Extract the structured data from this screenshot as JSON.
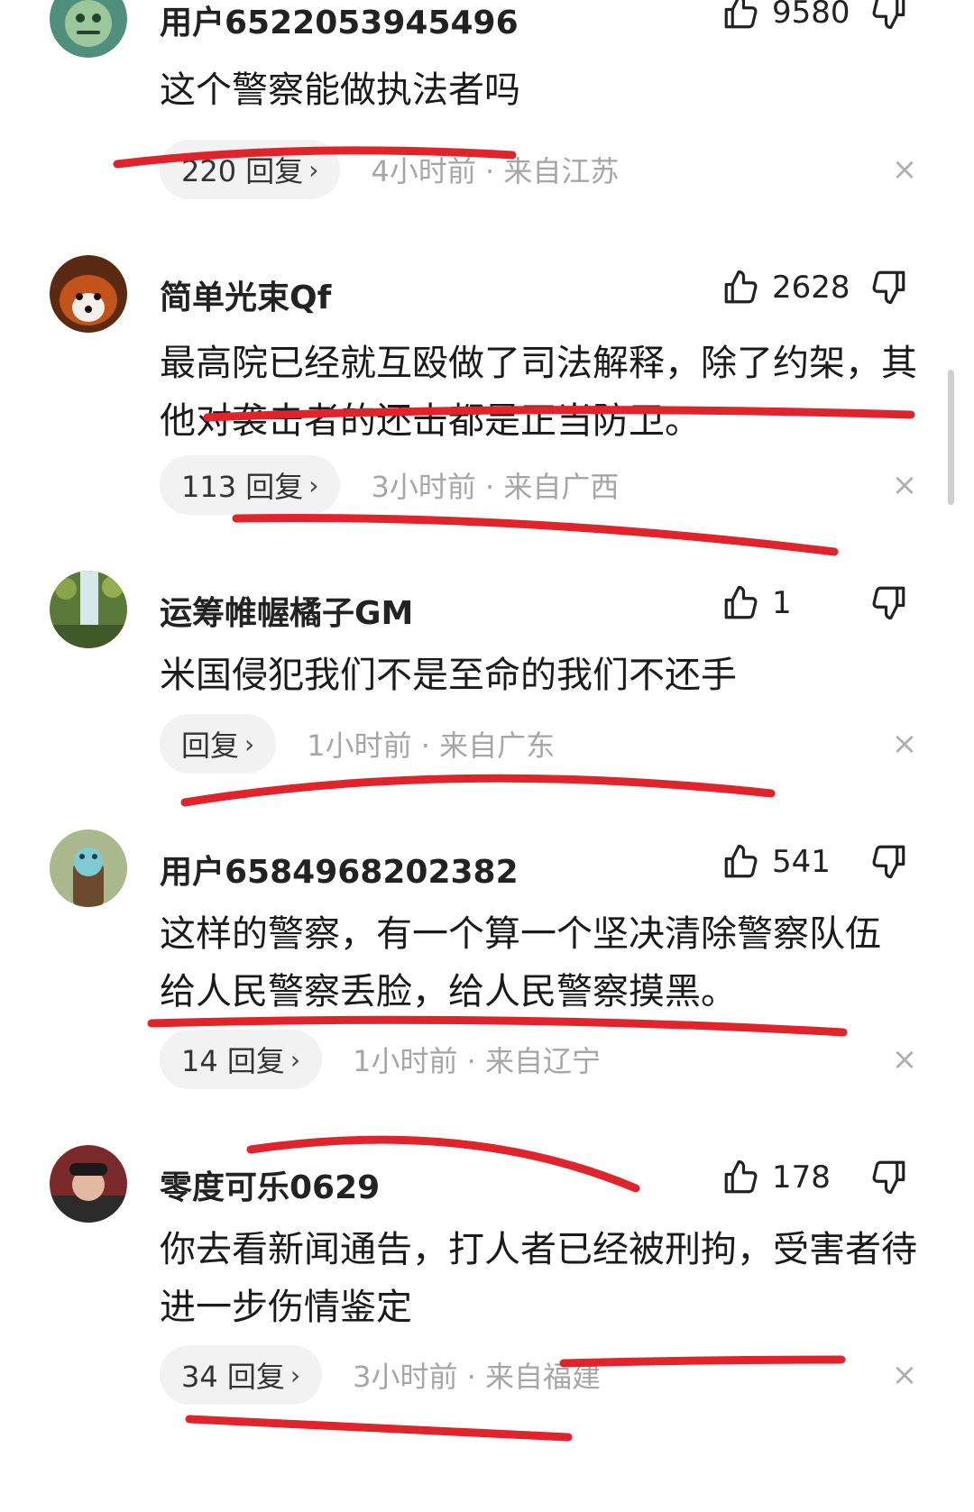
{
  "comments": [
    {
      "username": "用户6522053945496",
      "likes": "9580",
      "text": "这个警察能做执法者吗",
      "reply_label": "220 回复",
      "meta": "4小时前 · 来自江苏"
    },
    {
      "username": "简单光束Qf",
      "likes": "2628",
      "text": "最高院已经就互殴做了司法解释，除了约架，其他对袭击者的还击都是正当防卫。",
      "reply_label": "113 回复",
      "meta": "3小时前 · 来自广西"
    },
    {
      "username": "运筹帷幄橘子GM",
      "likes": "1",
      "text": "米国侵犯我们不是至命的我们不还手",
      "reply_label": "回复",
      "meta": "1小时前 · 来自广东"
    },
    {
      "username": "用户6584968202382",
      "likes": "541",
      "text": "这样的警察，有一个算一个坚决清除警察队伍 给人民警察丢脸，给人民警察摸黑。",
      "reply_label": "14 回复",
      "meta": "1小时前 · 来自辽宁"
    },
    {
      "username": "零度可乐0629",
      "likes": "178",
      "text": "你去看新闻通告，打人者已经被刑拘，受害者待进一步伤情鉴定",
      "reply_label": "34 回复",
      "meta": "3小时前 · 来自福建"
    }
  ],
  "icons": {
    "like": "thumbs-up-icon",
    "dislike": "thumbs-down-icon",
    "close": "close-icon",
    "chevron": "chevron-right-icon"
  },
  "colors": {
    "annotation_red": "#e0242b",
    "meta_gray": "#a6a6a6",
    "reply_bg": "#f2f2f2"
  },
  "glyphs": {
    "chevron": "›",
    "close": "×"
  }
}
